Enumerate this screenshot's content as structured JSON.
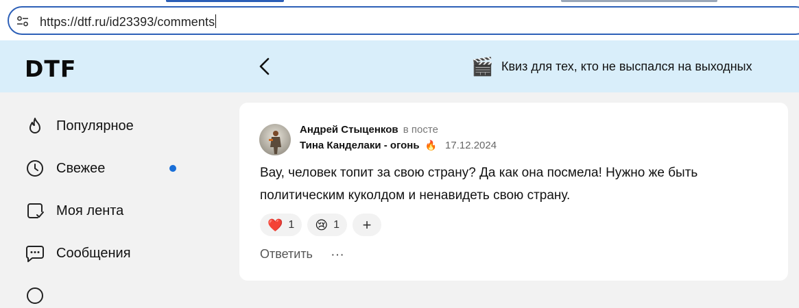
{
  "browser": {
    "url": "https://dtf.ru/id23393/comments"
  },
  "header": {
    "logo": "DTF",
    "promo_icon": "🎬",
    "promo_text": "Квиз для тех, кто не выспался на выходных"
  },
  "sidebar": {
    "items": [
      {
        "label": "Популярное",
        "icon": "flame-icon"
      },
      {
        "label": "Свежее",
        "icon": "clock-icon",
        "has_new": true
      },
      {
        "label": "Моя лента",
        "icon": "feed-check-icon"
      },
      {
        "label": "Сообщения",
        "icon": "chat-bubble-icon"
      }
    ]
  },
  "comment": {
    "author": "Андрей Стыценков",
    "in_post_label": "в посте",
    "post_title": "Тина Канделаки - огонь",
    "post_emoji": "🔥",
    "date": "17.12.2024",
    "text": "Вау, человек топит за свою страну? Да как она посмела! Нужно же быть политическим куколдом и ненавидеть свою страну.",
    "reactions": [
      {
        "emoji": "❤️",
        "count": "1"
      },
      {
        "emoji": "😢",
        "count": "1"
      }
    ],
    "add_reaction_label": "+",
    "reply_label": "Ответить",
    "more_label": "···"
  },
  "colors": {
    "header_bg": "#d9eefa",
    "page_bg": "#f2f2f2",
    "accent_blue": "#1a6fd8",
    "address_border": "#2c5fb7"
  }
}
